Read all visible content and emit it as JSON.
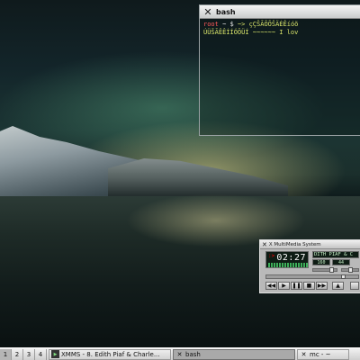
{
  "bash_window": {
    "title": "bash",
    "prompt_user": "root",
    "prompt_symbol": "~ $",
    "line1_rest": " ~> çÇŠÃÕÕŠÄÉÊíóõ",
    "line2": "ÚÜŠÃÊÊÍÍÓÕÜÍ ~~~~~~ I lov"
  },
  "xmms_window": {
    "title": "X MultiMedia System",
    "mode": ":>",
    "time": "02:27",
    "song": "DITH PIAF & C",
    "kbps": "160",
    "khz": "44",
    "buttons": {
      "prev": "◀◀",
      "play": "▶",
      "pause": "❚❚",
      "stop": "■",
      "next": "▶▶",
      "eject": "▲"
    },
    "seek_fraction": 0.86
  },
  "taskbar": {
    "workspaces": [
      "1",
      "2",
      "3",
      "4"
    ],
    "tasks": [
      {
        "label": "XMMS - 8. Edith Piaf & Charle...",
        "icon": "xmms-icon"
      },
      {
        "label": "bash",
        "icon": "x-icon"
      },
      {
        "label": "mc - ~",
        "icon": "x-icon"
      }
    ]
  }
}
